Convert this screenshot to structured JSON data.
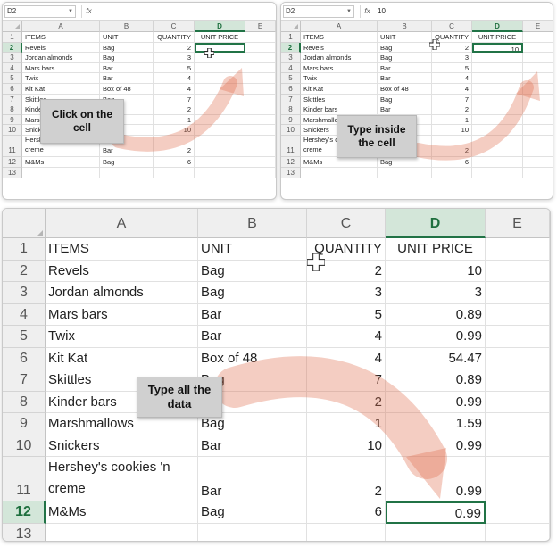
{
  "columns": [
    "A",
    "B",
    "C",
    "D",
    "E"
  ],
  "header_row": [
    "ITEMS",
    "UNIT",
    "QUANTITY",
    "UNIT PRICE"
  ],
  "rows": [
    {
      "n": "2",
      "item": "Revels",
      "unit": "Bag",
      "qty": "2",
      "price": "10"
    },
    {
      "n": "3",
      "item": "Jordan almonds",
      "unit": "Bag",
      "qty": "3",
      "price": "3"
    },
    {
      "n": "4",
      "item": "Mars bars",
      "unit": "Bar",
      "qty": "5",
      "price": "0.89"
    },
    {
      "n": "5",
      "item": "Twix",
      "unit": "Bar",
      "qty": "4",
      "price": "0.99"
    },
    {
      "n": "6",
      "item": "Kit Kat",
      "unit": "Box of 48",
      "qty": "4",
      "price": "54.47"
    },
    {
      "n": "7",
      "item": "Skittles",
      "unit": "Bag",
      "qty": "7",
      "price": "0.89"
    },
    {
      "n": "8",
      "item": "Kinder bars",
      "unit": "Bar",
      "qty": "2",
      "price": "0.99"
    },
    {
      "n": "9",
      "item": "Marshmallows",
      "unit": "Bag",
      "qty": "1",
      "price": "1.59"
    },
    {
      "n": "10",
      "item": "Snickers",
      "unit": "Bar",
      "qty": "10",
      "price": "0.99"
    },
    {
      "n": "11",
      "item": "Hershey's cookies 'n creme",
      "unit": "Bar",
      "qty": "2",
      "price": "0.99"
    },
    {
      "n": "12",
      "item": "M&Ms",
      "unit": "Bag",
      "qty": "6",
      "price": "0.99"
    }
  ],
  "steps": [
    {
      "callout": "Click on the cell",
      "namebox": "D2",
      "formula": "",
      "price_shown_rows": 0
    },
    {
      "callout": "Type inside the cell",
      "namebox": "D2",
      "formula": "10",
      "price_shown_rows": 1
    },
    {
      "callout": "Type all the data",
      "namebox": "",
      "formula": "",
      "price_shown_rows": 11
    }
  ],
  "fx_label": "fx",
  "colors": {
    "accent": "#217346",
    "arrow": "#e07050",
    "callout_bg": "#d0d0d0"
  }
}
